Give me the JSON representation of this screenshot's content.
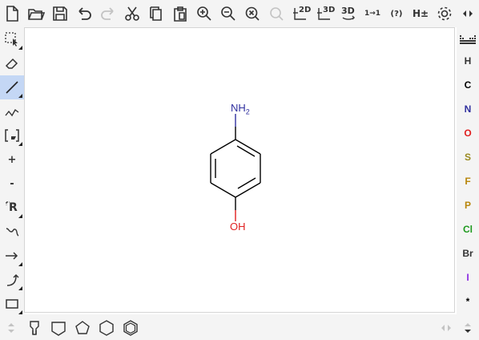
{
  "toolbar": {
    "zoom_in_label": "+",
    "layout_2d_label": "2D",
    "clean_3d_label": "3D",
    "optimize_3d_label": "3D",
    "numbering_label": "1→1",
    "check_label": "(?)",
    "explicit_h_label": "H±"
  },
  "left_tools": {
    "charge_plus": "+",
    "charge_minus": "-",
    "rgroup_label": "R"
  },
  "atoms": [
    {
      "label": "H",
      "color": "#333333"
    },
    {
      "label": "C",
      "color": "#000000"
    },
    {
      "label": "N",
      "color": "#30309f"
    },
    {
      "label": "O",
      "color": "#e02020"
    },
    {
      "label": "S",
      "color": "#9a8a20"
    },
    {
      "label": "F",
      "color": "#b8860b"
    },
    {
      "label": "P",
      "color": "#b8860b"
    },
    {
      "label": "Cl",
      "color": "#1f9a1f"
    },
    {
      "label": "Br",
      "color": "#333333"
    },
    {
      "label": "I",
      "color": "#8a2be2"
    },
    {
      "label": "*",
      "color": "#000000"
    }
  ],
  "molecule": {
    "amine_label": "NH",
    "amine_subscript": "2",
    "hydroxyl_label": "OH",
    "nitrogen_color": "#30309f",
    "oxygen_color": "#e02020"
  }
}
